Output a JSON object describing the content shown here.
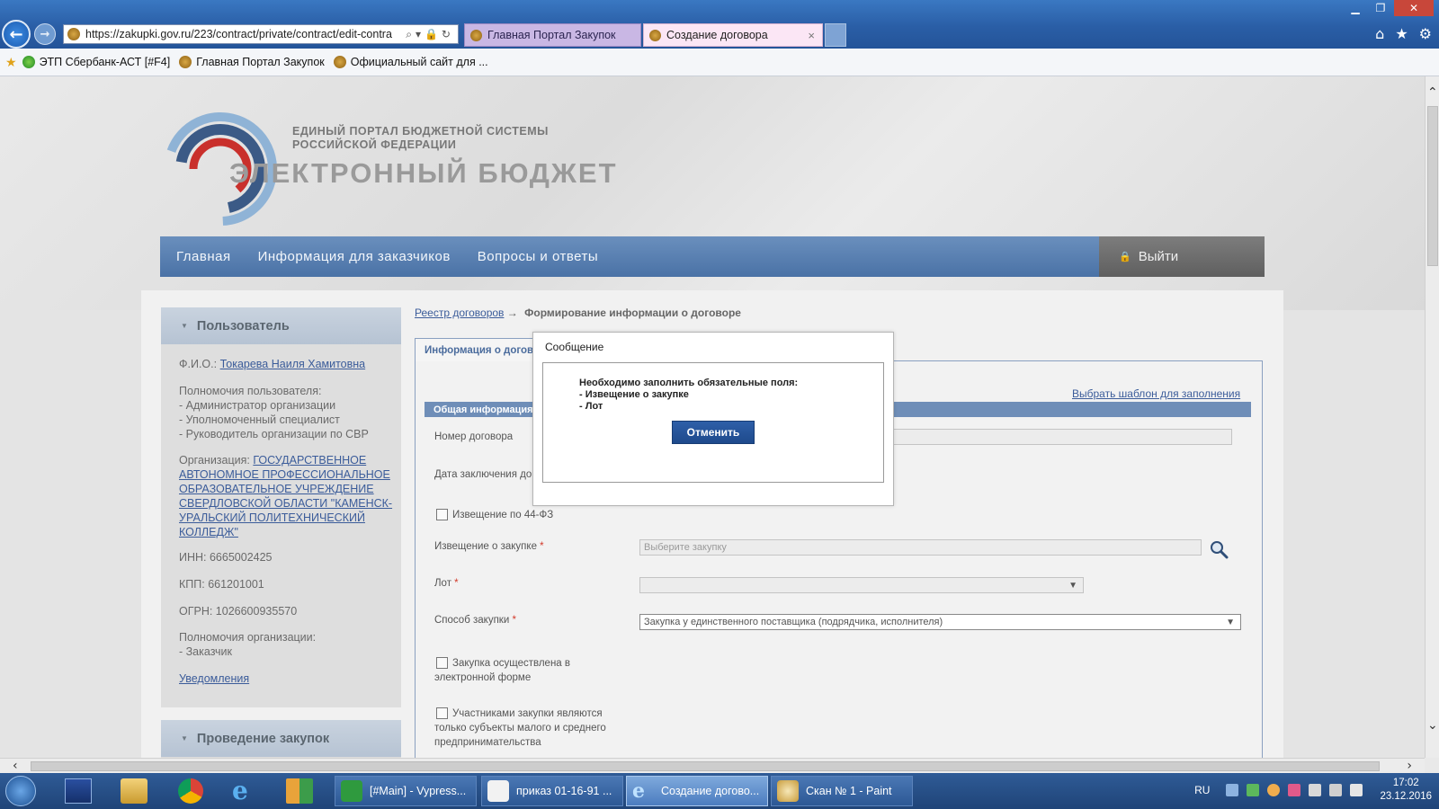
{
  "browser": {
    "url": "https://zakupki.gov.ru/223/contract/private/contract/edit-contra",
    "tabs": [
      {
        "label": "Главная Портал Закупок"
      },
      {
        "label": "Создание договора",
        "close": "×"
      }
    ],
    "favorites": [
      {
        "label": "ЭТП Сбербанк-АСТ [#F4]"
      },
      {
        "label": "Главная Портал Закупок"
      },
      {
        "label": "Официальный сайт для ..."
      }
    ]
  },
  "header": {
    "logo_line1": "ЕДИНЫЙ ПОРТАЛ БЮДЖЕТНОЙ СИСТЕМЫ",
    "logo_line2": "РОССИЙСКОЙ ФЕДЕРАЦИИ",
    "logo_big": "ЭЛЕКТРОННЫЙ БЮДЖЕТ"
  },
  "nav": {
    "items": [
      {
        "label": "Главная"
      },
      {
        "label": "Информация для заказчиков"
      },
      {
        "label": "Вопросы и ответы"
      }
    ],
    "logout": "Выйти"
  },
  "sidebar": {
    "user_title": "Пользователь",
    "fio_label": "Ф.И.О.:",
    "fio_value": "Токарева Наиля Хамитовна",
    "rights_title": "Полномочия пользователя:",
    "rights": [
      "- Администратор организации",
      "- Уполномоченный специалист",
      "- Руководитель организации по СВР"
    ],
    "org_label": "Организация:",
    "org_value": [
      "ГОСУДАРСТВЕННОЕ",
      "АВТОНОМНОЕ ПРОФЕССИОНАЛЬНОЕ",
      "ОБРАЗОВАТЕЛЬНОЕ УЧРЕЖДЕНИЕ",
      "СВЕРДЛОВСКОЙ ОБЛАСТИ \"КАМЕНСК-",
      "УРАЛЬСКИЙ ПОЛИТЕХНИЧЕСКИЙ",
      "КОЛЛЕДЖ\""
    ],
    "inn": "ИНН: 6665002425",
    "kpp": "КПП: 661201001",
    "ogrn": "ОГРН: 1026600935570",
    "org_rights_title": "Полномочия организации:",
    "org_rights": "- Заказчик",
    "notifications": "Уведомления",
    "procurement_title": "Проведение закупок"
  },
  "main": {
    "breadcrumb_link": "Реестр договоров",
    "breadcrumb_arrow": "→",
    "breadcrumb_current": "Формирование информации о договоре",
    "form_tab": "Информация о догово",
    "template_link": "Выбрать шаблон для заполнения",
    "section_title": "Общая информация",
    "fields": {
      "contract_number": "Номер договора",
      "conclusion_date": "Дата заключения дог",
      "notice_44fz": "Извещение по 44-ФЗ",
      "notice_label": "Извещение о закупке",
      "notice_placeholder": "Выберите закупку",
      "lot_label": "Лот",
      "method_label": "Способ закупки",
      "method_value": "Закупка у единственного поставщика (подрядчика, исполнителя)",
      "electronic_1": "Закупка осуществлена в",
      "electronic_2": "электронной форме",
      "sme_1": "Участниками закупки являются",
      "sme_2": "только субъекты малого и среднего",
      "sme_3": "предпринимательства",
      "required_mark": "*"
    }
  },
  "modal": {
    "title": "Сообщение",
    "line1": "Необходимо заполнить обязательные поля:",
    "line2": "- Извещение о закупке",
    "line3": "- Лот",
    "button": "Отменить"
  },
  "taskbar": {
    "tasks": [
      {
        "label": "[#Main] - Vypress..."
      },
      {
        "label": "приказ 01-16-91 ..."
      },
      {
        "label": "Создание догово..."
      },
      {
        "label": "Скан № 1 - Paint"
      }
    ],
    "lang": "RU",
    "time": "17:02",
    "date": "23.12.2016"
  },
  "colors": {
    "nav_blue": "#4a72a6",
    "link_blue": "#3b5c9a",
    "modal_button": "#1e4a8c",
    "required_red": "#d23a2a"
  }
}
